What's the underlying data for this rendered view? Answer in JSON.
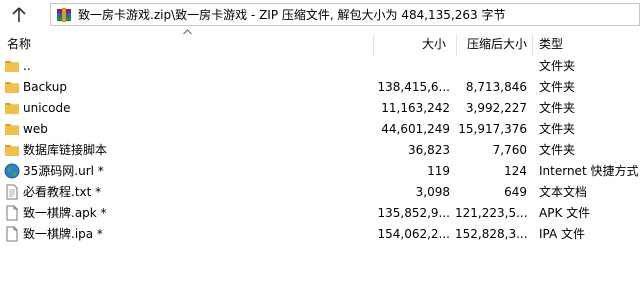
{
  "address_bar": {
    "path": "致一房卡游戏.zip\\致一房卡游戏 - ZIP 压缩文件, 解包大小为 484,135,263 字节"
  },
  "columns": {
    "name": "名称",
    "size": "大小",
    "packed": "压缩后大小",
    "type": "类型"
  },
  "colors": {
    "folder": "#f0c04a",
    "folder_dark": "#d9a21e",
    "separator": "#e3e3e3"
  },
  "rows": [
    {
      "name": "..",
      "size": "",
      "packed": "",
      "type": "文件夹",
      "icon": "folder-icon"
    },
    {
      "name": "Backup",
      "size": "138,415,6...",
      "packed": "8,713,846",
      "type": "文件夹",
      "icon": "folder-icon"
    },
    {
      "name": "unicode",
      "size": "11,163,242",
      "packed": "3,992,227",
      "type": "文件夹",
      "icon": "folder-icon"
    },
    {
      "name": "web",
      "size": "44,601,249",
      "packed": "15,917,376",
      "type": "文件夹",
      "icon": "folder-icon"
    },
    {
      "name": "数据库链接脚本",
      "size": "36,823",
      "packed": "7,760",
      "type": "文件夹",
      "icon": "folder-icon"
    },
    {
      "name": "35源码网.url *",
      "size": "119",
      "packed": "124",
      "type": "Internet 快捷方式",
      "icon": "globe-icon"
    },
    {
      "name": "必看教程.txt *",
      "size": "3,098",
      "packed": "649",
      "type": "文本文档",
      "icon": "text-file-icon"
    },
    {
      "name": "致一棋牌.apk *",
      "size": "135,852,9...",
      "packed": "121,223,5...",
      "type": "APK 文件",
      "icon": "file-icon"
    },
    {
      "name": "致一棋牌.ipa *",
      "size": "154,062,2...",
      "packed": "152,828,3...",
      "type": "IPA 文件",
      "icon": "file-icon"
    }
  ]
}
